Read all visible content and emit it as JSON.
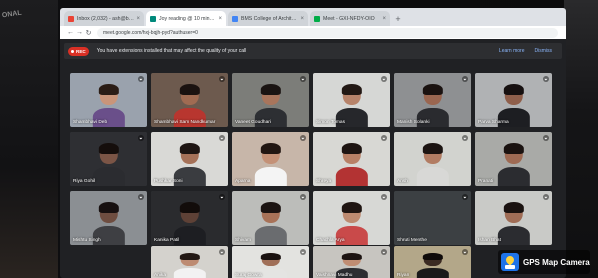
{
  "browser": {
    "tabs": [
      {
        "label": "Inbox (2,032) - ash@bmsce.ac.in",
        "active": false,
        "favicon_color": "#ea4335"
      },
      {
        "label": "Joy reading @ 10 minutes 2021",
        "active": true,
        "favicon_color": "#00897b"
      },
      {
        "label": "BMS College of Architecture",
        "active": false,
        "favicon_color": "#4285f4"
      },
      {
        "label": "Meet - GXI-NFDY-OIO",
        "active": false,
        "favicon_color": "#00ac47"
      }
    ],
    "url": "meet.google.com/hxj-bqjh-pyd?authuser=0"
  },
  "banner": {
    "rec_label": "REC",
    "message": "You have extensions installed that may affect the quality of your call",
    "learn_more": "Learn more",
    "dismiss": "Dismiss"
  },
  "participants": [
    {
      "name": "Shambhavi Deb",
      "tone": "#c9957a",
      "shirt": "#6a4f8a",
      "bg": "#9aa2ad",
      "hair": "#2b1d16"
    },
    {
      "name": "Shambhavi Sam Nandkumar",
      "tone": "#a06b52",
      "shirt": "#b8362f",
      "bg": "#6d5a4e",
      "hair": "#1b1210"
    },
    {
      "name": "Vaneet Goudhari",
      "tone": "#a8755c",
      "shirt": "#2d2f33",
      "bg": "#7c7d79",
      "hair": "#1a1412"
    },
    {
      "name": "Simon Tomas",
      "tone": "#b7836a",
      "shirt": "#26272b",
      "bg": "#d6d7d5",
      "hair": "#221814"
    },
    {
      "name": "Manish Solanki",
      "tone": "#9a6650",
      "shirt": "#2a2b2f",
      "bg": "#8e9092",
      "hair": "#1a1210"
    },
    {
      "name": "Parva Sharma",
      "tone": "#8f5f4b",
      "shirt": "#1d1e22",
      "bg": "#b0b2b4",
      "hair": "#161010"
    },
    {
      "name": "Riya Gohil",
      "tone": "#7b5546",
      "shirt": "#2b2c30",
      "bg": "#2e2f33",
      "hair": "#150e0c"
    },
    {
      "name": "Pushkar Soni",
      "tone": "#a57158",
      "shirt": "#3a3c40",
      "bg": "#d9d9d6",
      "hair": "#1e1512"
    },
    {
      "name": "Aparna",
      "tone": "#c49177",
      "shirt": "#f4f4f4",
      "bg": "#c7b6a9",
      "hair": "#221612"
    },
    {
      "name": "Shreya",
      "tone": "#b88066",
      "shirt": "#b33333",
      "bg": "#d8d8d4",
      "hair": "#1d1412"
    },
    {
      "name": "Ansh",
      "tone": "#b27c63",
      "shirt": "#d8d8d6",
      "bg": "#d2d3cf",
      "hair": "#1c1412"
    },
    {
      "name": "Pranati",
      "tone": "#9e6a53",
      "shirt": "#2b2c30",
      "bg": "#a9aaa7",
      "hair": "#1a1210"
    },
    {
      "name": "Mishtu Singh",
      "tone": "#6e4d40",
      "shirt": "#3e3f43",
      "bg": "#8b8f93",
      "hair": "#171010"
    },
    {
      "name": "Kanika Patil",
      "tone": "#5e4136",
      "shirt": "#1d1e22",
      "bg": "#2a2b2e",
      "hair": "#120c0a"
    },
    {
      "name": "Shivam",
      "tone": "#a87258",
      "shirt": "#6a6c6f",
      "bg": "#bcbdba",
      "hair": "#1c1412"
    },
    {
      "name": "Chachla Arya",
      "tone": "#bd8a70",
      "shirt": "#c94a4a",
      "bg": "#d7d8d5",
      "hair": "#1f1512"
    },
    {
      "name": "Shruti Menthe",
      "tone": "#111111",
      "shirt": "#111111",
      "bg": "#3c4043",
      "hair": "#111111"
    },
    {
      "name": "Ishan Bhat",
      "tone": "#a06d56",
      "shirt": "#2b2c30",
      "bg": "#c9cac7",
      "hair": "#1a1210"
    },
    {
      "name": "Anika",
      "tone": "#bd8b72",
      "shirt": "#f2f2f2",
      "bg": "#d4d2cd",
      "hair": "#231814"
    },
    {
      "name": "Suraj Gowra",
      "tone": "#a06f58",
      "shirt": "#e4e4e2",
      "bg": "#e3e3e0",
      "hair": "#1a1210"
    },
    {
      "name": "Vaishnavi Madhu",
      "tone": "#c08d73",
      "shirt": "#2d2e32",
      "bg": "#c7c5c0",
      "hair": "#1c1412"
    },
    {
      "name": "Riyan",
      "tone": "#3a2a22",
      "shirt": "#1a1a1a",
      "bg": "#b3a789",
      "hair": "#0f0b0a"
    }
  ],
  "watermark": {
    "label": "GPS Map Camera"
  },
  "photo": {
    "corner_text": "ONAL"
  }
}
